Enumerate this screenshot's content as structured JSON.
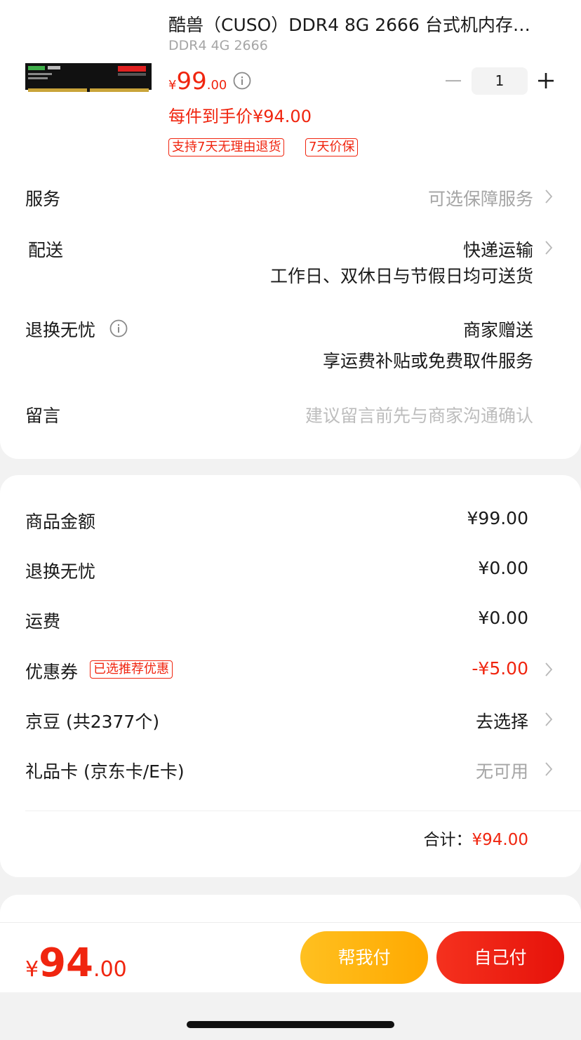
{
  "product": {
    "title": "酷兽（CUSO）DDR4 8G 2666 台式机内存…",
    "spec": "DDR4 4G 2666",
    "price": {
      "currency": "¥",
      "integer": "99",
      "decimal": ".00"
    },
    "quantity": "1",
    "arrival_price": "每件到手价¥94.00",
    "tags": [
      "支持7天无理由退货",
      "7天价保"
    ]
  },
  "options": {
    "service": {
      "label": "服务",
      "value": "可选保障服务"
    },
    "delivery": {
      "label": "配送",
      "value": "快递运输",
      "sub": "工作日、双休日与节假日均可送货"
    },
    "return": {
      "label": "退换无忧",
      "value": "商家赠送",
      "sub": "享运费补贴或免费取件服务"
    },
    "message": {
      "label": "留言",
      "placeholder": "建议留言前先与商家沟通确认"
    }
  },
  "summary": {
    "goods_amount": {
      "label": "商品金额",
      "value": "¥99.00"
    },
    "return_worry": {
      "label": "退换无忧",
      "value": "¥0.00"
    },
    "shipping": {
      "label": "运费",
      "value": "¥0.00"
    },
    "coupon": {
      "label": "优惠券",
      "tag": "已选推荐优惠",
      "value": "-¥5.00"
    },
    "jingdou": {
      "label": "京豆 (共2377个)",
      "value": "去选择"
    },
    "gift_card": {
      "label": "礼品卡 (京东卡/E卡)",
      "value": "无可用"
    },
    "total_label": "合计：",
    "total_value": "¥94.00"
  },
  "bottom": {
    "price": {
      "currency": "¥",
      "integer": "94",
      "decimal": ".00"
    },
    "help_pay": "帮我付",
    "self_pay": "自己付"
  },
  "colors": {
    "accent": "#f0250f",
    "help_button": "#ffb514",
    "self_button": "#ec1c12"
  },
  "icons": [
    "info-icon",
    "minus-icon",
    "plus-icon",
    "chevron-right-icon"
  ]
}
